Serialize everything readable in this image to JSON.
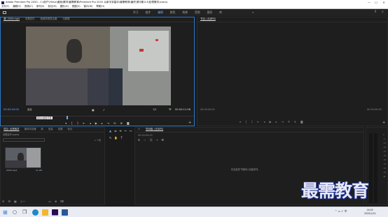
{
  "window": {
    "title": "Adobe Premiere Pro 2020 - C:\\用户\\Ykhui\\桌面\\素材\\最需教育\\Premiere Pro 2020 从新手到高手\\最需教育\\最终\\第3课\\3.3\\处理素材.prproj",
    "controls": [
      "—",
      "☐",
      "✕"
    ]
  },
  "menu": [
    "文件(F)",
    "编辑(E)",
    "剪辑(C)",
    "序列(S)",
    "标记(M)",
    "图形(G)",
    "视图(V)",
    "窗口(W)",
    "帮助(H)"
  ],
  "workspaces": {
    "tabs": [
      "学习",
      "组件",
      "编辑",
      "颜色",
      "效果",
      "音频",
      "图形",
      "库"
    ],
    "active": "编辑",
    "more": "»"
  },
  "source_monitor": {
    "tabs": [
      "源: 2020.mp4",
      "效果控件",
      "音频剪辑混合器",
      "元数据"
    ],
    "timecode_in": "00:00:03:00",
    "fit": "适合",
    "resolution": "1/2",
    "timecode_duration": "00:00:11:08",
    "tooltip": "拖动以缩放/平移"
  },
  "program_monitor": {
    "tabs": [
      "节目: (无序列)"
    ],
    "timecode_in": "00:00:00:00",
    "timecode_out": "00:00:00:00"
  },
  "project_panel": {
    "tabs": [
      "项目: 处理素材",
      "媒体浏览器",
      "库",
      "信息",
      "效果",
      "标记"
    ],
    "path": "处理素材.prproj",
    "item_count": "1 个项",
    "clip": {
      "name": "2020.mp4",
      "duration": "11:08"
    }
  },
  "timeline": {
    "tabs": [
      "时间轴: (无序列)"
    ],
    "timecode": "00:00:00:00",
    "empty_message": "在此处放下媒体以创建序列。"
  },
  "audio_meters": {
    "scale": [
      "0",
      "-6",
      "-12",
      "-18",
      "-24",
      "-30",
      "-36",
      "-42",
      "-48",
      "-54",
      "dB"
    ]
  },
  "taskbar": {
    "time": "16:25",
    "date": "2020/1/14",
    "apps": [
      "start",
      "search",
      "task-view",
      "edge",
      "explorer",
      "premiere",
      "word"
    ]
  },
  "watermark": "最需教育"
}
